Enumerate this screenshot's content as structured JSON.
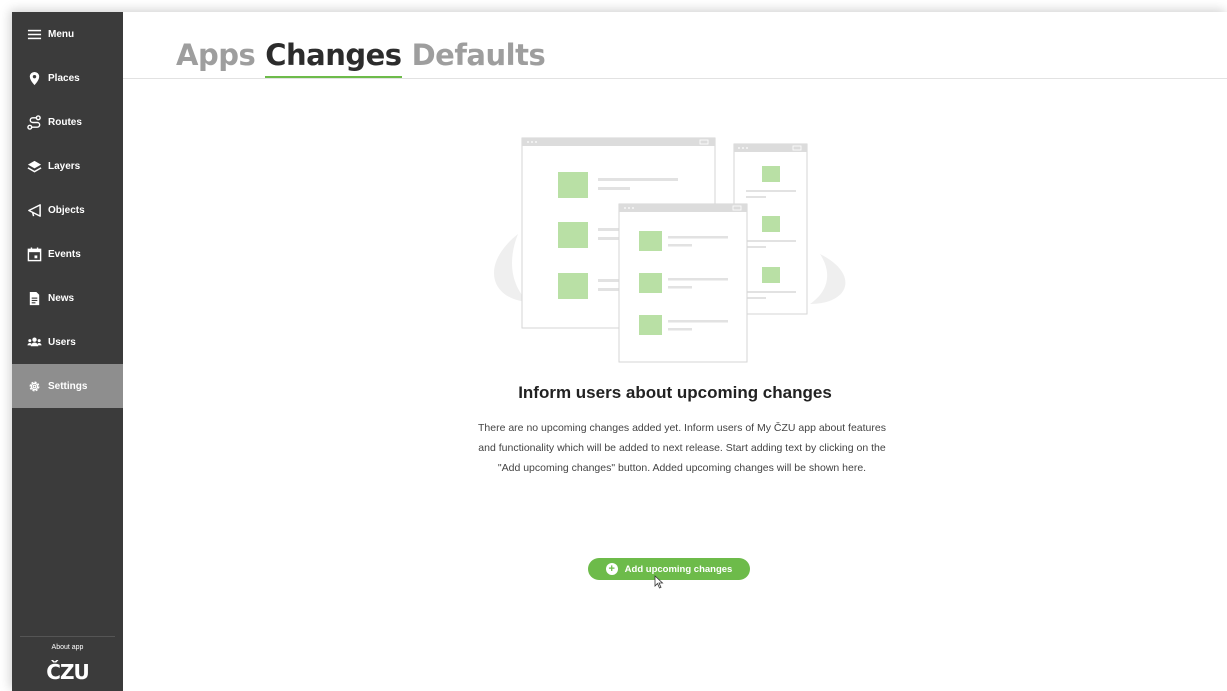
{
  "sidebar": {
    "items": [
      {
        "label": "Menu",
        "icon": "hamburger-icon"
      },
      {
        "label": "Places",
        "icon": "map-pin-icon"
      },
      {
        "label": "Routes",
        "icon": "route-icon"
      },
      {
        "label": "Layers",
        "icon": "layers-icon"
      },
      {
        "label": "Objects",
        "icon": "megaphone-icon"
      },
      {
        "label": "Events",
        "icon": "calendar-icon"
      },
      {
        "label": "News",
        "icon": "document-icon"
      },
      {
        "label": "Users",
        "icon": "users-icon"
      },
      {
        "label": "Settings",
        "icon": "gear-icon",
        "active": true
      }
    ],
    "about_label": "About app",
    "logo_text": "ČZU"
  },
  "tabs": [
    {
      "label": "Apps"
    },
    {
      "label": "Changes",
      "active": true
    },
    {
      "label": "Defaults"
    }
  ],
  "empty_state": {
    "heading": "Inform users about upcoming changes",
    "description_lines": [
      "There are no upcoming changes added yet. Inform users of My ČZU app about features",
      "and functionality which will be added to next release.  Start adding text by clicking on the",
      "\"Add upcoming changes\" button. Added upcoming changes will be shown here."
    ],
    "button_label": "Add upcoming changes"
  },
  "colors": {
    "sidebar_bg": "#3b3b3b",
    "sidebar_active": "#8e8e8e",
    "accent_green": "#6dbb4a",
    "illustration_green": "#b9e0a5"
  }
}
